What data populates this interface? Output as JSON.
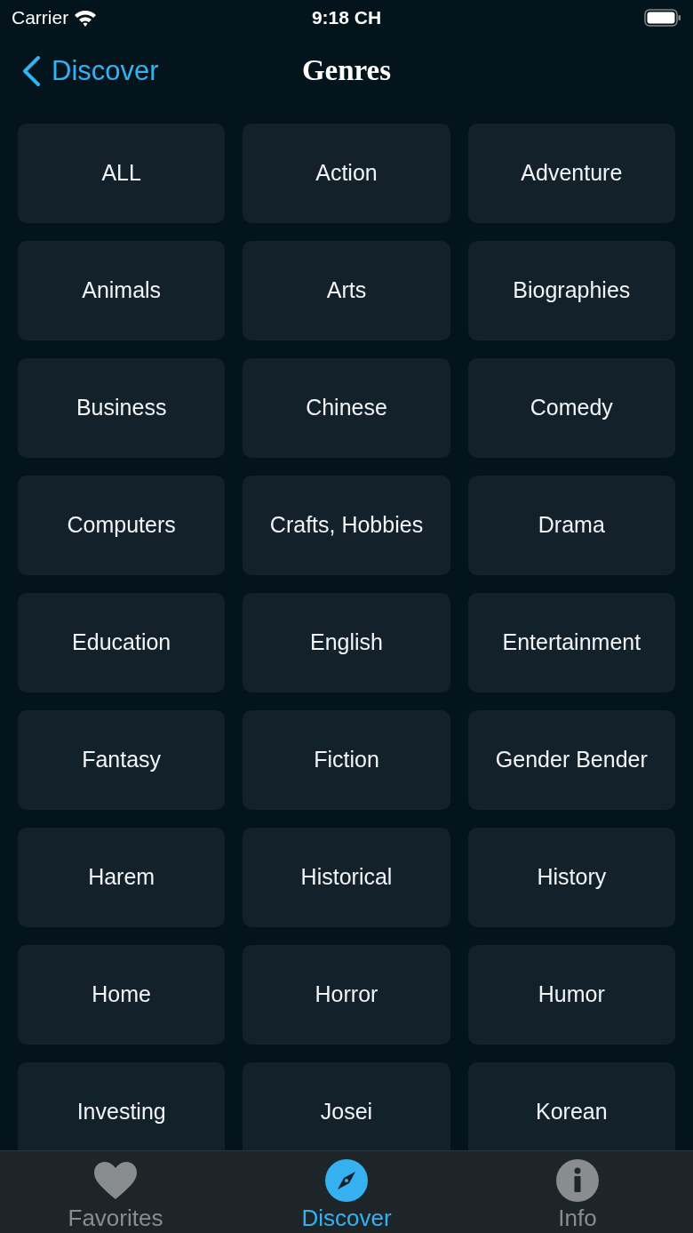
{
  "status_bar": {
    "carrier": "Carrier",
    "time": "9:18 CH"
  },
  "nav_bar": {
    "back": "Discover",
    "title": "Genres"
  },
  "genres": [
    "ALL",
    "Action",
    "Adventure",
    "Animals",
    "Arts",
    "Biographies",
    "Business",
    "Chinese",
    "Comedy",
    "Computers",
    "Crafts, Hobbies",
    "Drama",
    "Education",
    "English",
    "Entertainment",
    "Fantasy",
    "Fiction",
    "Gender Bender",
    "Harem",
    "Historical",
    "History",
    "Home",
    "Horror",
    "Humor",
    "Investing",
    "Josei",
    "Korean"
  ],
  "tab_bar": [
    {
      "kind": "heart",
      "label": "Favorites",
      "selected": false
    },
    {
      "kind": "compass",
      "label": "Discover",
      "selected": true
    },
    {
      "kind": "info",
      "label": "Info",
      "selected": false
    }
  ]
}
